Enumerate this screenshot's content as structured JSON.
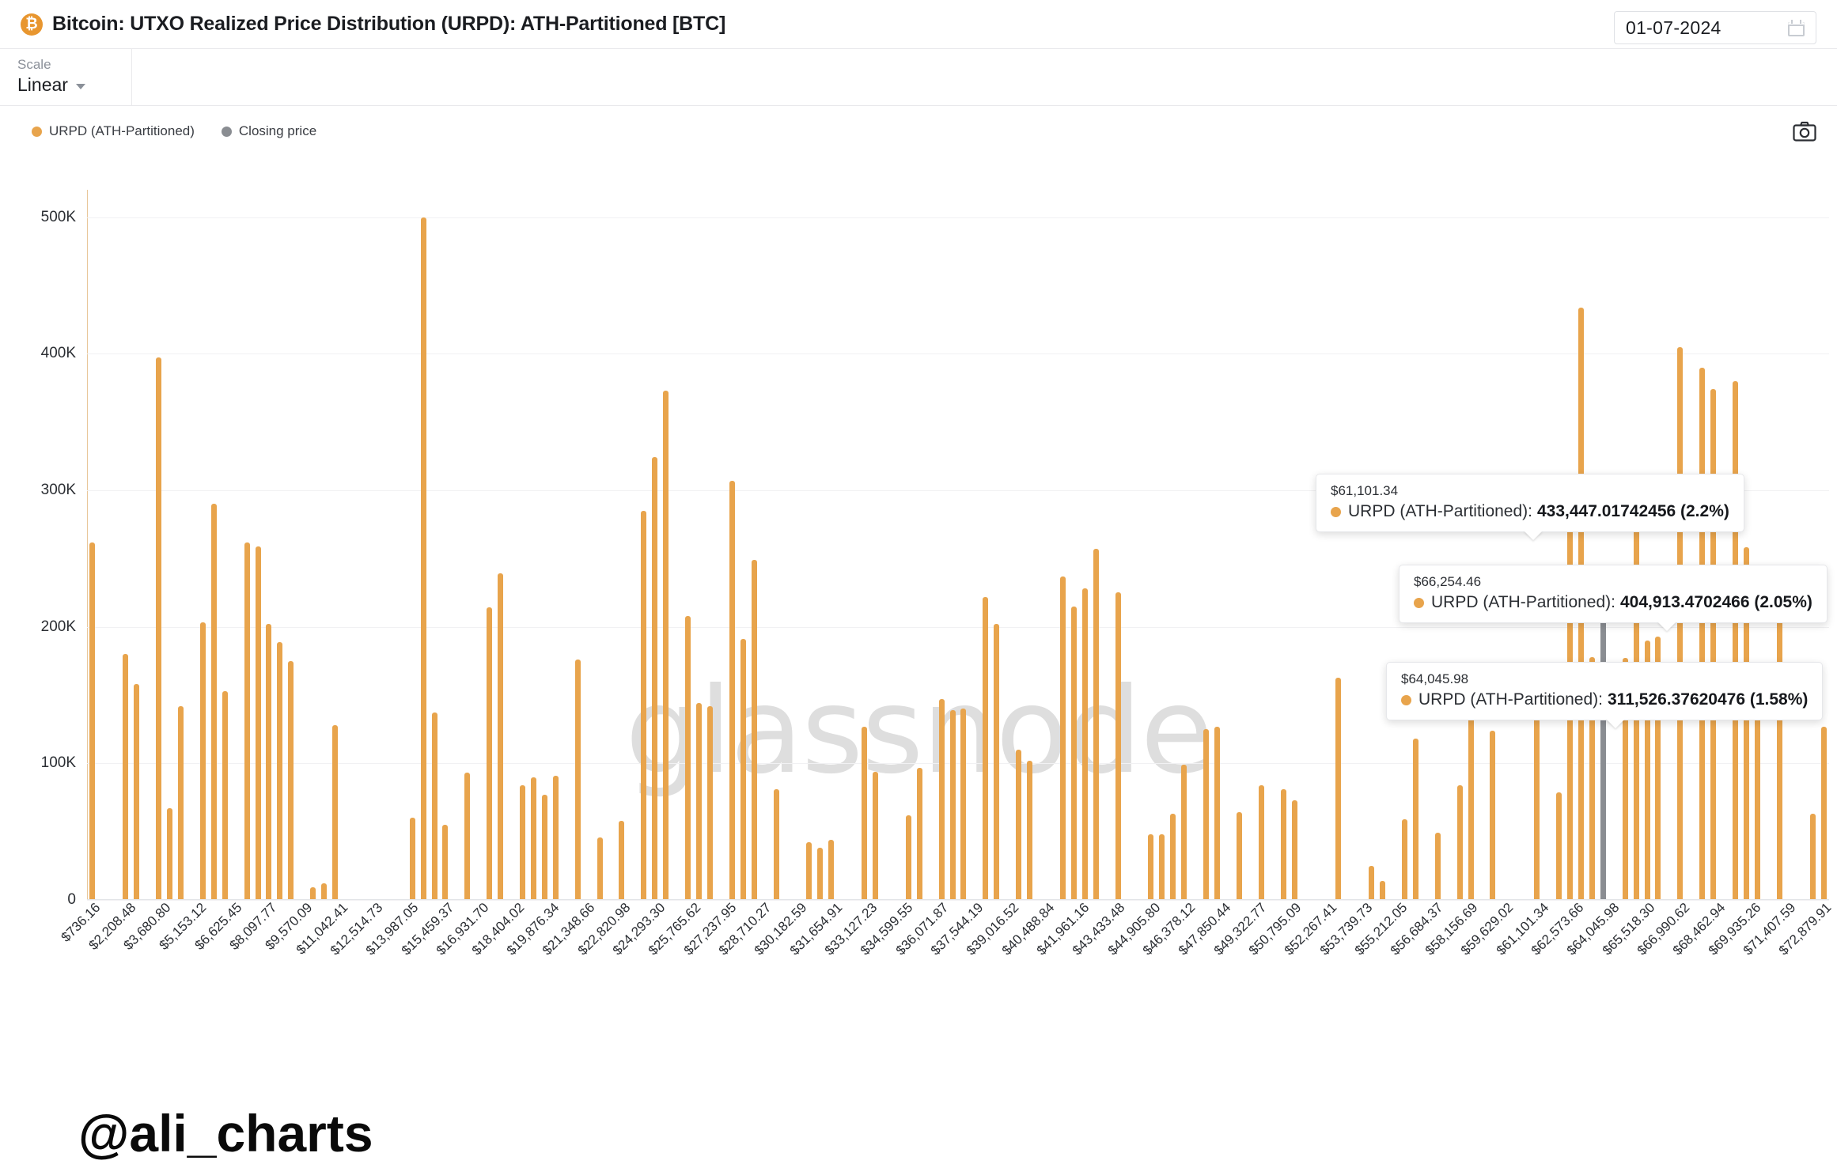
{
  "header": {
    "logo_icon": "bitcoin-icon",
    "logo_glyph": "₿",
    "title": "Bitcoin: UTXO Realized Price Distribution (URPD): ATH-Partitioned [BTC]",
    "date_value": "01-07-2024",
    "calendar_icon": "calendar-icon"
  },
  "controls": {
    "scale_label": "Scale",
    "scale_value": "Linear"
  },
  "legend": {
    "items": [
      {
        "label": "URPD (ATH-Partitioned)",
        "color": "#e8a44c"
      },
      {
        "label": "Closing price",
        "color": "#8a8d92"
      }
    ],
    "camera_icon": "camera-icon"
  },
  "watermarks": {
    "brand": "glassnode",
    "author": "@ali_charts"
  },
  "tooltips": [
    {
      "price": "$61,101.34",
      "label": "URPD (ATH-Partitioned):",
      "value": "433,447.01742456 (2.2%)",
      "color": "#e8a44c"
    },
    {
      "price": "$66,254.46",
      "label": "URPD (ATH-Partitioned):",
      "value": "404,913.4702466 (2.05%)",
      "color": "#e8a44c"
    },
    {
      "price": "$64,045.98",
      "label": "URPD (ATH-Partitioned):",
      "value": "311,526.37620476 (1.58%)",
      "color": "#e8a44c"
    }
  ],
  "chart_data": {
    "type": "bar",
    "title": "Bitcoin: UTXO Realized Price Distribution (URPD): ATH-Partitioned [BTC]",
    "xlabel": "",
    "ylabel": "",
    "ylim": [
      0,
      520000
    ],
    "yticks": [
      0,
      100000,
      200000,
      300000,
      400000,
      500000
    ],
    "ytick_labels": [
      "0",
      "100K",
      "200K",
      "300K",
      "400K",
      "500K"
    ],
    "grid": true,
    "legend_position": "top-left",
    "bar_color": "#e8a44c",
    "highlight_color": "#8a8d92",
    "xtick_labels": [
      "$736.16",
      "$2,208.48",
      "$3,680.80",
      "$5,153.12",
      "$6,625.45",
      "$8,097.77",
      "$9,570.09",
      "$11,042.41",
      "$12,514.73",
      "$13,987.05",
      "$15,459.37",
      "$16,931.70",
      "$18,404.02",
      "$19,876.34",
      "$21,348.66",
      "$22,820.98",
      "$24,293.30",
      "$25,765.62",
      "$27,237.95",
      "$28,710.27",
      "$30,182.59",
      "$31,654.91",
      "$33,127.23",
      "$34,599.55",
      "$36,071.87",
      "$37,544.19",
      "$39,016.52",
      "$40,488.84",
      "$41,961.16",
      "$43,433.48",
      "$44,905.80",
      "$46,378.12",
      "$47,850.44",
      "$49,322.77",
      "$50,795.09",
      "$52,267.41",
      "$53,739.73",
      "$55,212.05",
      "$56,684.37",
      "$58,156.69",
      "$59,629.02",
      "$61,101.34",
      "$62,573.66",
      "$64,045.98",
      "$65,518.30",
      "$66,990.62",
      "$68,462.94",
      "$69,935.26",
      "$71,407.59",
      "$72,879.91"
    ],
    "series": [
      {
        "name": "URPD (ATH-Partitioned)",
        "color": "#e8a44c",
        "values": [
          262000,
          0,
          0,
          180000,
          158000,
          0,
          397000,
          67000,
          142000,
          0,
          203000,
          290000,
          153000,
          0,
          262000,
          259000,
          202000,
          189000,
          175000,
          0,
          9000,
          12000,
          128000,
          0,
          0,
          0,
          0,
          0,
          0,
          60000,
          500000,
          137000,
          55000,
          0,
          93000,
          0,
          214000,
          239000,
          0,
          84000,
          90000,
          77000,
          91000,
          0,
          176000,
          0,
          46000,
          0,
          58000,
          0,
          285000,
          324000,
          373000,
          0,
          208000,
          144000,
          142000,
          0,
          307000,
          191000,
          249000,
          0,
          81000,
          0,
          0,
          42000,
          38000,
          44000,
          0,
          0,
          127000,
          94000,
          0,
          0,
          62000,
          97000,
          0,
          147000,
          139000,
          140000,
          0,
          222000,
          202000,
          0,
          110000,
          102000,
          0,
          0,
          237000,
          215000,
          228000,
          257000,
          0,
          225000,
          0,
          0,
          48000,
          48000,
          63000,
          99000,
          0,
          125000,
          127000,
          0,
          64000,
          0,
          84000,
          0,
          81000,
          73000,
          0,
          0,
          0,
          163000,
          0,
          0,
          25000,
          14000,
          0,
          59000,
          118000,
          0,
          49000,
          0,
          84000,
          141000,
          0,
          124000,
          0,
          0,
          0,
          166000,
          0,
          79000,
          301000,
          433447,
          178000,
          150000,
          0,
          177000,
          311526,
          190000,
          193000,
          0,
          404913,
          0,
          390000,
          374000,
          0,
          380000,
          258000,
          136000,
          0,
          235000,
          0,
          0,
          63000,
          127000
        ]
      },
      {
        "name": "Closing price",
        "color": "#8a8d92",
        "index": 137,
        "value": 236000
      }
    ]
  }
}
